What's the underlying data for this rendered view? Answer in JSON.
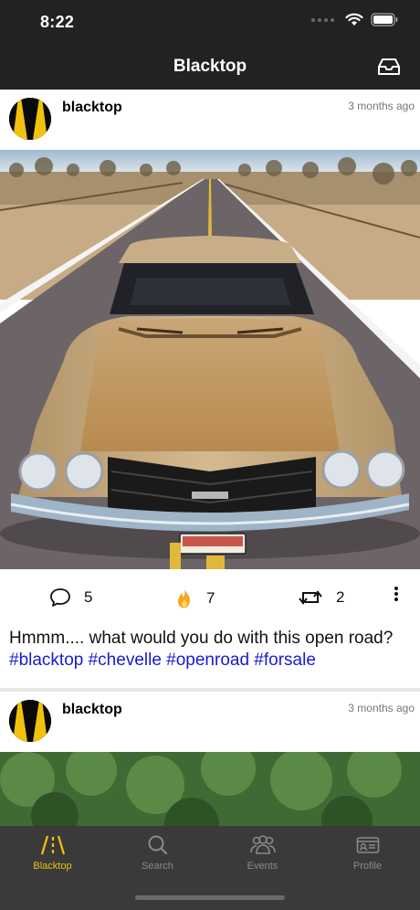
{
  "status_bar": {
    "time": "8:22"
  },
  "nav": {
    "title": "Blacktop",
    "inbox_icon": "inbox-icon"
  },
  "posts": [
    {
      "username": "blacktop",
      "time_ago": "3 months ago",
      "image": "classic-gold-car-on-open-road",
      "comments": "5",
      "likes": "7",
      "reposts": "2",
      "caption_text": "Hmmm.... what would you do with this open road? ",
      "caption_tags": "#blacktop #chevelle #openroad #forsale"
    },
    {
      "username": "blacktop",
      "time_ago": "3 months ago",
      "image": "green-trees"
    }
  ],
  "tabs": [
    {
      "label": "Blacktop",
      "icon": "road-icon",
      "active": true
    },
    {
      "label": "Search",
      "icon": "search-icon",
      "active": false
    },
    {
      "label": "Events",
      "icon": "people-icon",
      "active": false
    },
    {
      "label": "Profile",
      "icon": "id-card-icon",
      "active": false
    }
  ],
  "colors": {
    "accent": "#f2c20b",
    "hashtag": "#1a1ad1",
    "bar": "#222222",
    "tabbar": "#3a3a3a"
  }
}
